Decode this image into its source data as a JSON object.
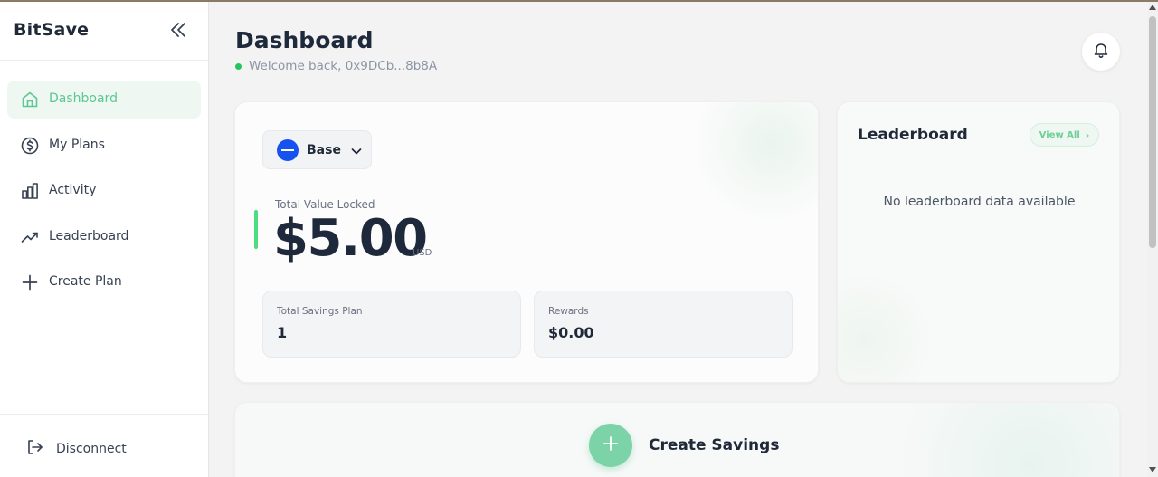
{
  "app": {
    "brand": "BitSave"
  },
  "sidebar": {
    "items": [
      {
        "label": "Dashboard",
        "icon": "home-icon",
        "active": true
      },
      {
        "label": "My Plans",
        "icon": "dollar-circle-icon",
        "active": false
      },
      {
        "label": "Activity",
        "icon": "bar-chart-icon",
        "active": false
      },
      {
        "label": "Leaderboard",
        "icon": "trending-up-icon",
        "active": false
      },
      {
        "label": "Create Plan",
        "icon": "plus-icon",
        "active": false
      }
    ],
    "disconnect_label": "Disconnect"
  },
  "header": {
    "title": "Dashboard",
    "welcome": "Welcome back, 0x9DCb...8b8A"
  },
  "overview": {
    "chain": "Base",
    "tvl_label": "Total Value Locked",
    "tvl_value": "$5.00",
    "tvl_unit": "USD",
    "stats": [
      {
        "label": "Total Savings Plan",
        "value": "1"
      },
      {
        "label": "Rewards",
        "value": "$0.00"
      }
    ]
  },
  "leaderboard": {
    "title": "Leaderboard",
    "view_all": "View All",
    "empty_text": "No leaderboard data available"
  },
  "create": {
    "label": "Create Savings"
  },
  "colors": {
    "accent": "#5cc792",
    "accent_light": "#eef7f1",
    "online_dot": "#22c55e",
    "base_chain": "#1652f0",
    "text_dark": "#1e293b"
  }
}
